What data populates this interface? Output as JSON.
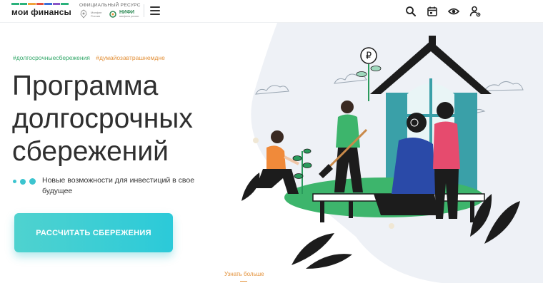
{
  "header": {
    "logo_text": "мои финансы",
    "logo_stripe_colors": [
      "#2ab27b",
      "#2ab27b",
      "#f0a33a",
      "#e04d3c",
      "#3a6fd8",
      "#8a56c8",
      "#2ab27b"
    ],
    "official_label": "ОФИЦИАЛЬНЫЙ РЕСУРС",
    "minfin_label": "Минфин России",
    "nifi_label": "НИФИ",
    "nifi_sub": "минфина россии",
    "icons": [
      "search-icon",
      "calendar-icon",
      "visibility-icon",
      "user-settings-icon"
    ]
  },
  "hero": {
    "hashtag_1": "#долгосрочныесбережения",
    "hashtag_2": "#думайозавтрашнемдне",
    "title": "Программа долгосрочных сбережений",
    "subtitle": "Новые возможности для инвестиций в свое будущее",
    "dot_colors": [
      "#3cc4cf",
      "#3cc4cf",
      "#3cc4cf"
    ],
    "cta_label": "РАССЧИТАТЬ СБЕРЕЖЕНИЯ",
    "learn_more": "Узнать больше"
  },
  "colors": {
    "accent": "#2bcad9",
    "green": "#34a86a",
    "orange": "#e3913a",
    "house": "#3aa0a8"
  },
  "illustration": {
    "sign_symbol": "₽"
  }
}
